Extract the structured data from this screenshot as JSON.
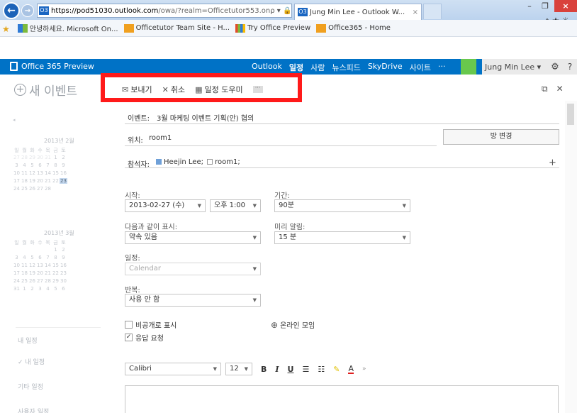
{
  "browser": {
    "url_host": "https://pod51030.outlook.com",
    "url_rest": "/owa/?realm=Officetutor553.on",
    "url_tools": "ρ ▾ 🔒 ↻",
    "favicon_text": "O3",
    "tab_title": "Jung Min Lee - Outlook W...",
    "tab_close": "×",
    "minimize": "–",
    "maximize": "❐",
    "close": "×",
    "toolbar_icons": "⌂★☼"
  },
  "favorites": [
    {
      "label": "안녕하세요. Microsoft On...",
      "icon": "ms"
    },
    {
      "label": "Officetutor Team Site - H...",
      "icon": "ot"
    },
    {
      "label": "Try Office Preview",
      "icon": "try"
    },
    {
      "label": "Office365 - Home",
      "icon": "o365"
    }
  ],
  "o365": {
    "brand": "Office 365 Preview",
    "nav": [
      "Outlook",
      "일정",
      "사람",
      "뉴스피드",
      "SkyDrive",
      "사이트",
      "···"
    ],
    "active_nav": "일정",
    "user": "Jung Min Lee ▾",
    "gear": "⚙",
    "help": "?"
  },
  "left": {
    "new_event": "새 이벤트",
    "mini1_title": "2013년 2월",
    "mini2_title": "2013년 3월",
    "weekday_header": [
      "일",
      "월",
      "화",
      "수",
      "목",
      "금",
      "토"
    ],
    "feb_rows": [
      [
        "27",
        "28",
        "29",
        "30",
        "31",
        "1",
        "2"
      ],
      [
        "3",
        "4",
        "5",
        "6",
        "7",
        "8",
        "9"
      ],
      [
        "10",
        "11",
        "12",
        "13",
        "14",
        "15",
        "16"
      ],
      [
        "17",
        "18",
        "19",
        "20",
        "21",
        "22",
        "23"
      ],
      [
        "24",
        "25",
        "26",
        "27",
        "28",
        "",
        ""
      ]
    ],
    "mar_rows": [
      [
        "",
        "",
        "",
        "",
        "",
        "1",
        "2"
      ],
      [
        "3",
        "4",
        "5",
        "6",
        "7",
        "8",
        "9"
      ],
      [
        "10",
        "11",
        "12",
        "13",
        "14",
        "15",
        "16"
      ],
      [
        "17",
        "18",
        "19",
        "20",
        "21",
        "22",
        "23"
      ],
      [
        "24",
        "25",
        "26",
        "27",
        "28",
        "29",
        "30"
      ],
      [
        "31",
        "1",
        "2",
        "3",
        "4",
        "5",
        "6"
      ]
    ],
    "links": [
      "내 일정",
      "✓ 내 일정",
      "기타 일정",
      "사용자 일정"
    ],
    "prev_arrow": "◂"
  },
  "toolbar": {
    "send": "보내기",
    "cancel": "취소",
    "scheduling": "일정 도우미",
    "more": "···",
    "popout": "⧉",
    "close": "✕"
  },
  "form": {
    "event_label": "이벤트:",
    "event_value": "3월 마케팅 이벤트 기획(안) 협의",
    "location_label": "위치:",
    "location_value": "room1",
    "change_room": "방 변경",
    "attendees_label": "참석자:",
    "attendee1": "Heejin Lee;",
    "attendee2": "room1;",
    "add": "+",
    "start_label": "시작:",
    "start_date": "2013-02-27 (수)",
    "start_time": "오후 1:00",
    "duration_label": "기간:",
    "duration": "90분",
    "showas_label": "다음과 같이 표시:",
    "showas": "약속 있음",
    "reminder_label": "미리 알림:",
    "reminder": "15 분",
    "calendar_label": "일정:",
    "calendar": "Calendar",
    "repeat_label": "반복:",
    "repeat": "사용 안 함",
    "private_label": "비공개로 표시",
    "response_label": "응답 요청",
    "online_meeting": "온라인 모임"
  },
  "format": {
    "font": "Calibri",
    "size": "12",
    "bold": "B",
    "italic": "I",
    "underline": "U",
    "bullets": "☰",
    "numbering": "☷",
    "highlight": "✎",
    "fontcolor": "A",
    "more": "»"
  }
}
